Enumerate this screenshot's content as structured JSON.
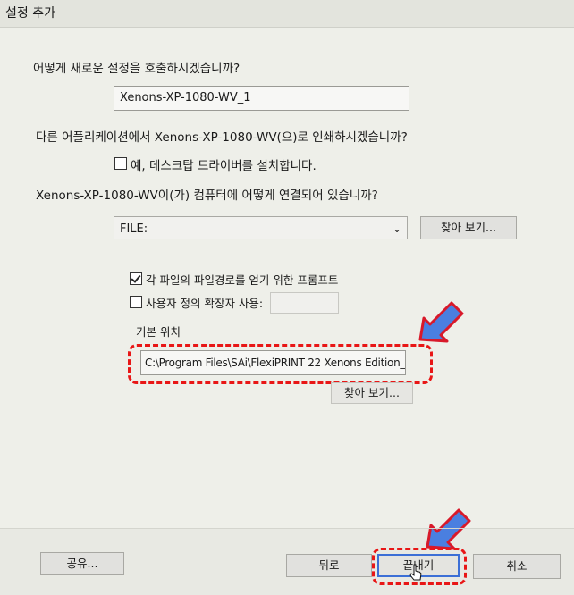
{
  "window": {
    "title": "설정 추가"
  },
  "form": {
    "name_question": "어떻게 새로운 설정을 호출하시겠습니까?",
    "name_value": "Xenons-XP-1080-WV_1",
    "print_question": "다른 어플리케이션에서 Xenons-XP-1080-WV(으)로 인쇄하시겠습니까?",
    "install_driver_label": "예, 데스크탑 드라이버를 설치합니다.",
    "install_driver_checked": false,
    "connect_question": "Xenons-XP-1080-WV이(가) 컴퓨터에 어떻게 연결되어 있습니까?",
    "port_value": "FILE:",
    "browse_label": "찾아 보기...",
    "prompt_path_label": "각 파일의 파일경로를 얻기 위한 프롬프트",
    "prompt_path_checked": true,
    "custom_ext_label": "사용자 정의 확장자 사용:",
    "custom_ext_checked": false,
    "custom_ext_value": "",
    "default_location_label": "기본 위치",
    "default_location_value": "C:\\Program Files\\SAi\\FlexiPRINT 22 Xenons Edition_",
    "browse2_label": "찾아 보기..."
  },
  "footer": {
    "share_label": "공유...",
    "back_label": "뒤로",
    "export_label": "끝내기",
    "cancel_label": "취소"
  },
  "colors": {
    "highlight": "#e81616",
    "arrow_fill": "#4a7fe0",
    "arrow_stroke": "#d8192a"
  }
}
